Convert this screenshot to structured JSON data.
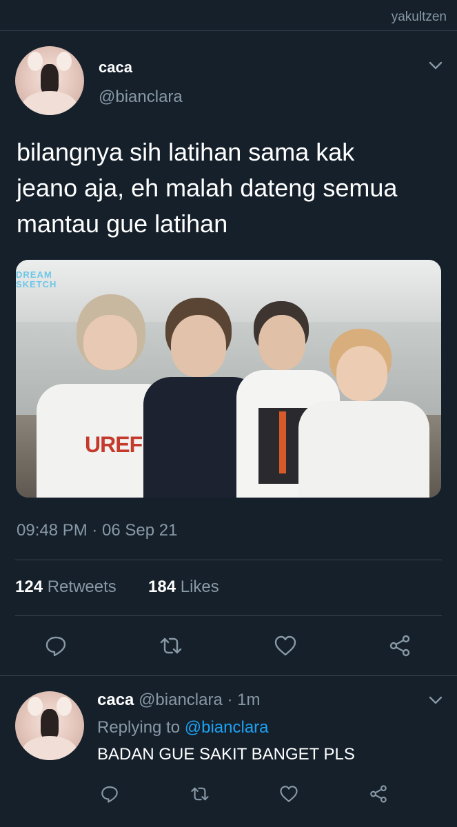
{
  "watermark": "yakultzen",
  "tweet": {
    "display_name": "caca",
    "handle": "@bianclara",
    "text_lines": [
      "bilangnya sih latihan sama kak",
      "jeano aja, eh malah dateng semua",
      "mantau gue latihan"
    ],
    "media": {
      "logo_lines": [
        "DREAM",
        "SKETCH"
      ],
      "shirt_text": "UREF"
    },
    "timestamp": "09:48 PM · 06 Sep 21",
    "stats": {
      "retweets_count": "124",
      "retweets_label": "Retweets",
      "likes_count": "184",
      "likes_label": "Likes"
    },
    "actions": [
      "reply-icon",
      "retweet-icon",
      "like-icon",
      "share-icon"
    ]
  },
  "reply": {
    "display_name": "caca",
    "handle": "@bianclara",
    "separator": "·",
    "time": "1m",
    "replying_prefix": "Replying to",
    "replying_to": "@bianclara",
    "text": "BADAN GUE SAKIT BANGET PLS"
  },
  "colors": {
    "background": "#15202b",
    "secondary_text": "#8899a6",
    "link": "#1da1f2",
    "divider": "#38444d"
  }
}
